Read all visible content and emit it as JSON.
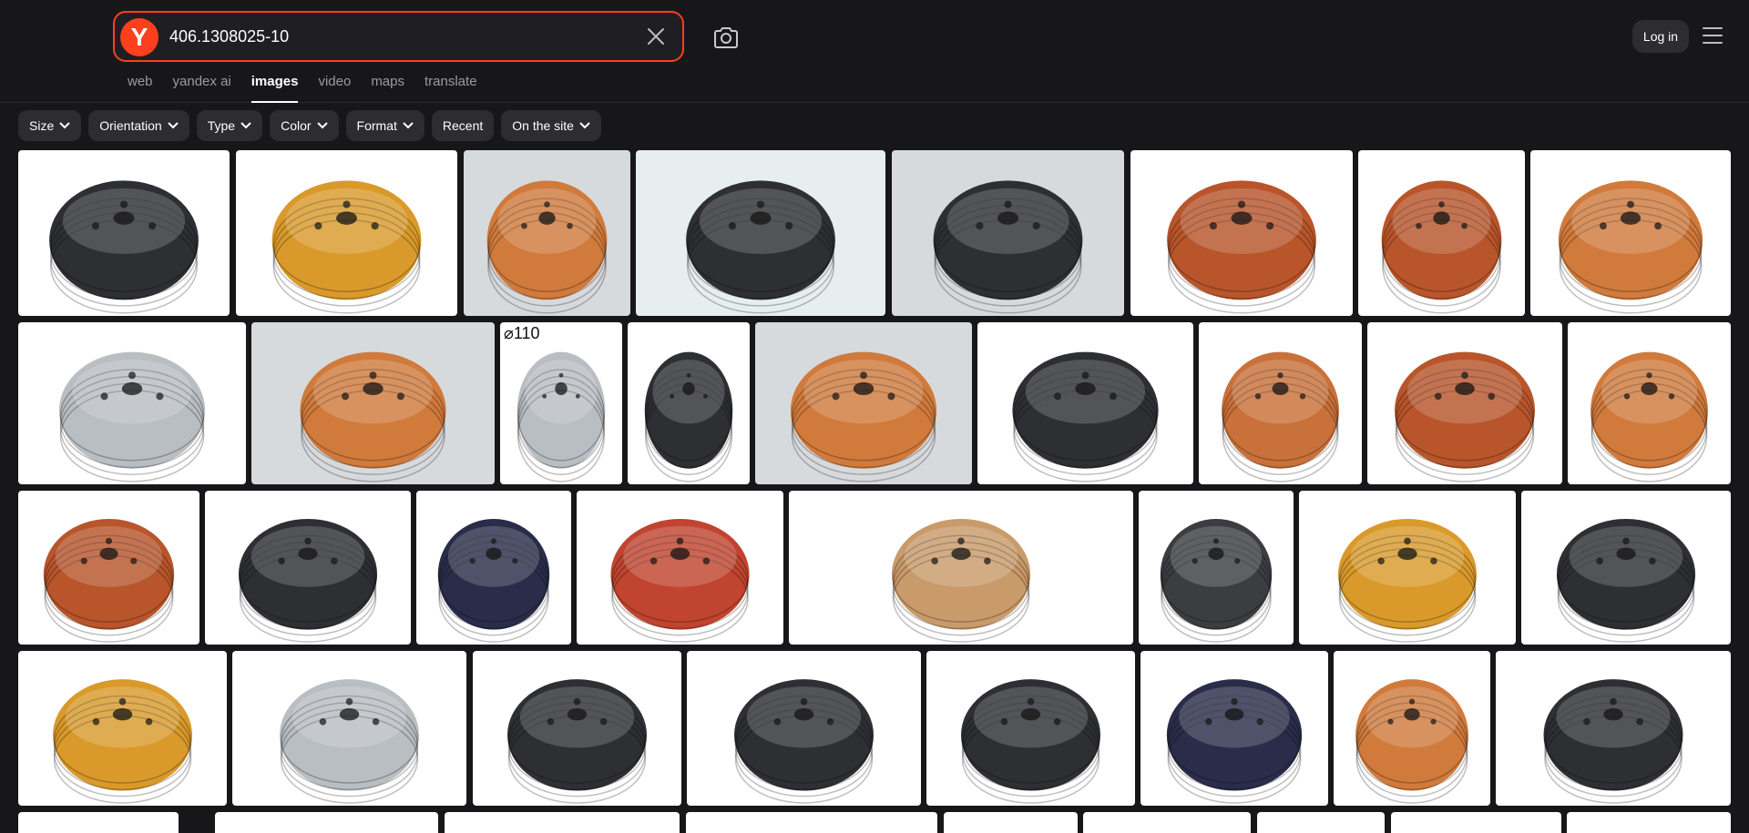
{
  "search": {
    "logo": "Y",
    "query": "406.1308025-10",
    "clear_icon": "close-icon",
    "camera_icon": "camera-icon"
  },
  "tabs": [
    {
      "label": "web",
      "active": false
    },
    {
      "label": "yandex ai",
      "active": false
    },
    {
      "label": "images",
      "active": true
    },
    {
      "label": "video",
      "active": false
    },
    {
      "label": "maps",
      "active": false
    },
    {
      "label": "translate",
      "active": false
    }
  ],
  "header": {
    "login_label": "Log in",
    "menu_icon": "hamburger-menu-icon"
  },
  "filters": [
    {
      "label": "Size",
      "dropdown": true
    },
    {
      "label": "Orientation",
      "dropdown": true
    },
    {
      "label": "Type",
      "dropdown": true
    },
    {
      "label": "Color",
      "dropdown": true
    },
    {
      "label": "Format",
      "dropdown": true
    },
    {
      "label": "Recent",
      "dropdown": false
    },
    {
      "label": "On the site",
      "dropdown": true
    }
  ],
  "results": {
    "colors": {
      "black": "#2e2f33",
      "gold": "#d99a2b",
      "orange": "#d07a3c",
      "rust": "#b8552b",
      "terracotta": "#c9713a",
      "silver": "#b9bec3",
      "navy": "#2a2c4a",
      "tan": "#c99a6a",
      "red": "#c0442f",
      "darkgrey": "#3b3d40"
    },
    "image_tiles": [
      {
        "alt": "black pulley"
      },
      {
        "alt": "yellow pulley"
      },
      {
        "alt": "orange pulley"
      },
      {
        "alt": "dark pulley"
      },
      {
        "alt": "black pulley"
      },
      {
        "alt": "rust pulley"
      },
      {
        "alt": "rust pulley"
      },
      {
        "alt": "orange pulley"
      },
      {
        "alt": "silver pulley"
      },
      {
        "alt": "amber pulley"
      },
      {
        "alt": "silver pulley"
      },
      {
        "alt": "black pulley"
      },
      {
        "alt": "amber pulley"
      },
      {
        "alt": "black pulley"
      },
      {
        "alt": "orange pulley"
      },
      {
        "alt": "red pulley"
      },
      {
        "alt": "orange pulley"
      },
      {
        "alt": "rust pulley"
      },
      {
        "alt": "black pulley"
      },
      {
        "alt": "navy pulley"
      },
      {
        "alt": "red pulley"
      },
      {
        "alt": "tan pulley"
      },
      {
        "alt": "black pulley"
      },
      {
        "alt": "gold pulley"
      },
      {
        "alt": "black pulley"
      },
      {
        "alt": "gold pulley"
      },
      {
        "alt": "silver pulley"
      },
      {
        "alt": "black pulley"
      },
      {
        "alt": "black pulley"
      },
      {
        "alt": "black pulley"
      },
      {
        "alt": "navy pulley"
      },
      {
        "alt": "orange pulley"
      },
      {
        "alt": "black pulley"
      }
    ],
    "overlay_labels": [
      "110"
    ]
  }
}
